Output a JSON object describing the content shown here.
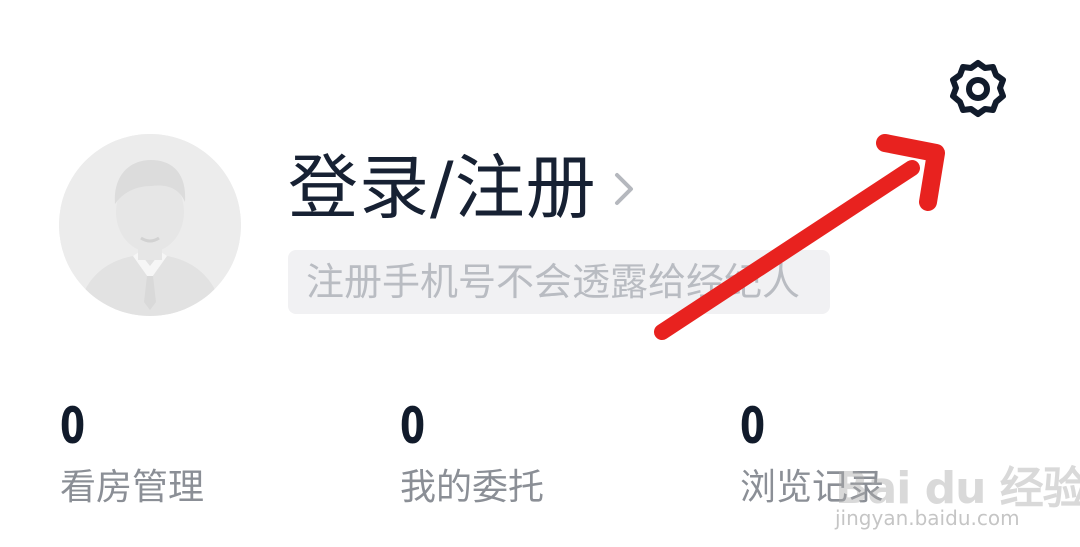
{
  "profile": {
    "login_label": "登录/注册",
    "hint": "注册手机号不会透露给经纪人"
  },
  "stats": [
    {
      "value": "0",
      "label": "看房管理"
    },
    {
      "value": "0",
      "label": "我的委托"
    },
    {
      "value": "0",
      "label": "浏览记录"
    }
  ],
  "icons": {
    "settings": "gear-icon",
    "login_chevron": "chevron-right-icon",
    "avatar": "default-avatar-icon"
  },
  "annotation": {
    "arrow_color": "#e8221f"
  },
  "watermark": {
    "brand": "Bai du 经验",
    "url": "jingyan.baidu.com"
  },
  "colors": {
    "text_dark": "#111b2b",
    "text_muted": "#8b8f96",
    "hint_bg": "#f1f1f3",
    "hint_text": "#b9bcc2"
  }
}
